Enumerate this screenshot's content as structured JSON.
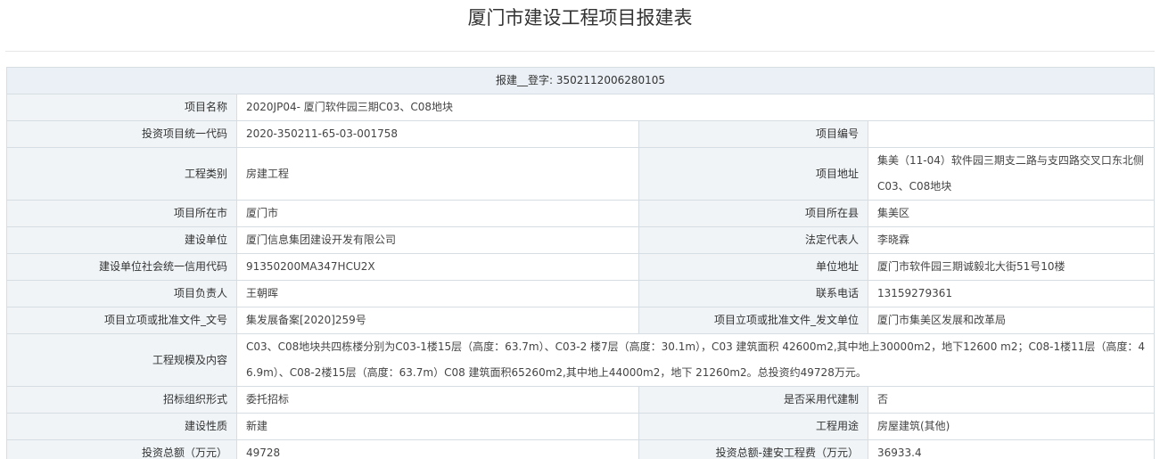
{
  "page": {
    "title": "厦门市建设工程项目报建表"
  },
  "header": {
    "label": "报建__登字:",
    "value": "3502112006280105"
  },
  "rows": {
    "project_name": {
      "label": "项目名称",
      "value": "2020JP04- 厦门软件园三期C03、C08地块"
    },
    "invest_code": {
      "label": "投资项目统一代码",
      "value": "2020-350211-65-03-001758"
    },
    "project_no": {
      "label": "项目编号",
      "value": ""
    },
    "project_type": {
      "label": "工程类别",
      "value": "房建工程"
    },
    "project_addr": {
      "label": "项目地址",
      "value": "集美（11-04）软件园三期支二路与支四路交叉口东北侧C03、C08地块"
    },
    "city": {
      "label": "项目所在市",
      "value": "厦门市"
    },
    "county": {
      "label": "项目所在县",
      "value": "集美区"
    },
    "builder": {
      "label": "建设单位",
      "value": "厦门信息集团建设开发有限公司"
    },
    "legal_rep": {
      "label": "法定代表人",
      "value": "李晓霖"
    },
    "credit_code": {
      "label": "建设单位社会统一信用代码",
      "value": "91350200MA347HCU2X"
    },
    "unit_addr": {
      "label": "单位地址",
      "value": "厦门市软件园三期诚毅北大街51号10楼"
    },
    "manager": {
      "label": "项目负责人",
      "value": "王朝晖"
    },
    "phone": {
      "label": "联系电话",
      "value": "13159279361"
    },
    "approval_doc_no": {
      "label": "项目立项或批准文件_文号",
      "value": "集发展备案[2020]259号"
    },
    "approval_issuer": {
      "label": "项目立项或批准文件_发文单位",
      "value": "厦门市集美区发展和改革局"
    },
    "scale": {
      "label": "工程规模及内容",
      "value": "C03、C08地块共四栋楼分别为C03-1楼15层（高度：63.7m）、C03-2 楼7层（高度：30.1m），C03 建筑面积 42600m2,其中地上30000m2，地下12600 m2；C08-1楼11层（高度：46.9m）、C08-2楼15层（高度：63.7m）C08 建筑面积65260m2,其中地上44000m2，地下 21260m2。总投资约49728万元。"
    },
    "bid_form": {
      "label": "招标组织形式",
      "value": "委托招标"
    },
    "agent_system": {
      "label": "是否采用代建制",
      "value": "否"
    },
    "nature": {
      "label": "建设性质",
      "value": "新建"
    },
    "usage": {
      "label": "工程用途",
      "value": "房屋建筑(其他)"
    },
    "total_invest": {
      "label": "投资总额（万元）",
      "value": "49728"
    },
    "construct_cost": {
      "label": "投资总额-建安工程费（万元）",
      "value": "36933.4"
    }
  }
}
